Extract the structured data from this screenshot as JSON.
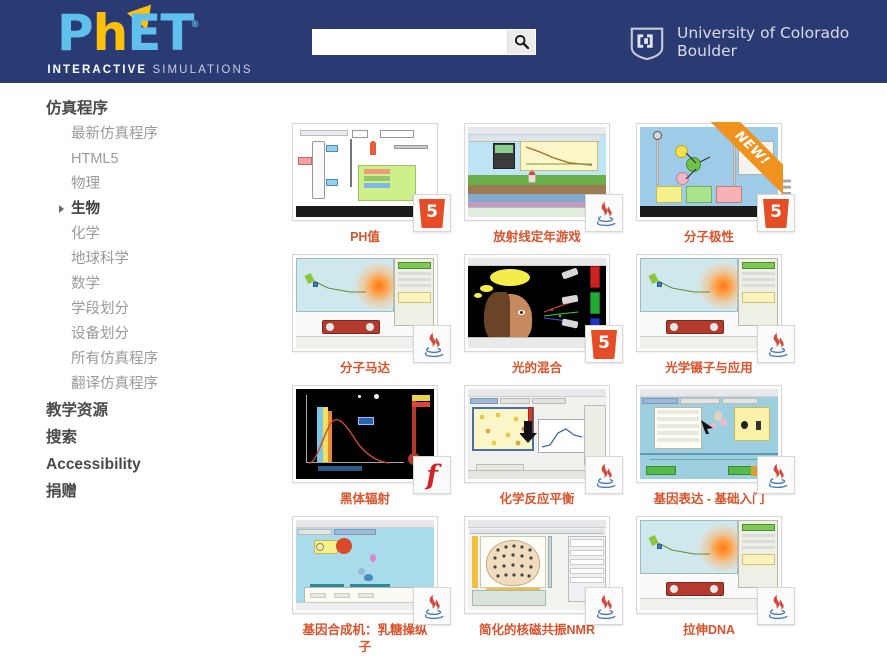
{
  "header": {
    "logo": {
      "wordmark": "PhET",
      "registered": "®",
      "tagline_bold": "INTERACTIVE",
      "tagline_light": "SIMULATIONS"
    },
    "search": {
      "value": "",
      "placeholder": "",
      "button_icon": "search-icon"
    },
    "university": {
      "mark": "cu-logo",
      "line1": "University of Colorado",
      "line2": "Boulder"
    },
    "bg_color": "#2a3b74"
  },
  "sidebar": {
    "items": [
      {
        "label": "仿真程序",
        "level": "top",
        "active": false
      },
      {
        "label": "最新仿真程序",
        "level": "sub",
        "active": false
      },
      {
        "label": "HTML5",
        "level": "sub",
        "active": false
      },
      {
        "label": "物理",
        "level": "sub",
        "active": false
      },
      {
        "label": "生物",
        "level": "sub",
        "active": true
      },
      {
        "label": "化学",
        "level": "sub",
        "active": false
      },
      {
        "label": "地球科学",
        "level": "sub",
        "active": false
      },
      {
        "label": "数学",
        "level": "sub",
        "active": false
      },
      {
        "label": "学段划分",
        "level": "sub",
        "active": false
      },
      {
        "label": "设备划分",
        "level": "sub",
        "active": false
      },
      {
        "label": "所有仿真程序",
        "level": "sub",
        "active": false
      },
      {
        "label": "翻译仿真程序",
        "level": "sub",
        "active": false
      },
      {
        "label": "教学资源",
        "level": "top",
        "active": false
      },
      {
        "label": "搜索",
        "level": "top",
        "active": false
      },
      {
        "label": "Accessibility",
        "level": "top",
        "active": false
      },
      {
        "label": "捐赠",
        "level": "top",
        "active": false
      }
    ]
  },
  "main": {
    "view_toggle": {
      "grid_icon": "grid-view-icon",
      "list_icon": "list-view-icon",
      "selected": "grid"
    },
    "accent_color": "#d9532c",
    "sims": [
      {
        "title": "PH值",
        "badge": "html5",
        "new": false,
        "art": "ph-scale"
      },
      {
        "title": "放射线定年游戏",
        "badge": "java",
        "new": false,
        "art": "radioactive-dating"
      },
      {
        "title": "分子极性",
        "badge": "html5",
        "new": true,
        "art": "molecule-polarity"
      },
      {
        "title": "分子马达",
        "badge": "java",
        "new": false,
        "art": "optical-tweezers"
      },
      {
        "title": "光的混合",
        "badge": "html5",
        "new": false,
        "art": "color-vision"
      },
      {
        "title": "光学镊子与应用",
        "badge": "java",
        "new": false,
        "art": "optical-tweezers"
      },
      {
        "title": "黑体辐射",
        "badge": "flash",
        "new": false,
        "art": "blackbody"
      },
      {
        "title": "化学反应平衡",
        "badge": "java",
        "new": false,
        "art": "reactions-rates"
      },
      {
        "title": "基因表达 - 基础入门",
        "badge": "java",
        "new": false,
        "art": "gene-expression"
      },
      {
        "title": "基因合成机：乳糖操纵子",
        "badge": "java",
        "new": false,
        "art": "lac-operon"
      },
      {
        "title": "简化的核磁共振NMR",
        "badge": "java",
        "new": false,
        "art": "mri"
      },
      {
        "title": "拉伸DNA",
        "badge": "java",
        "new": false,
        "art": "optical-tweezers"
      }
    ]
  }
}
